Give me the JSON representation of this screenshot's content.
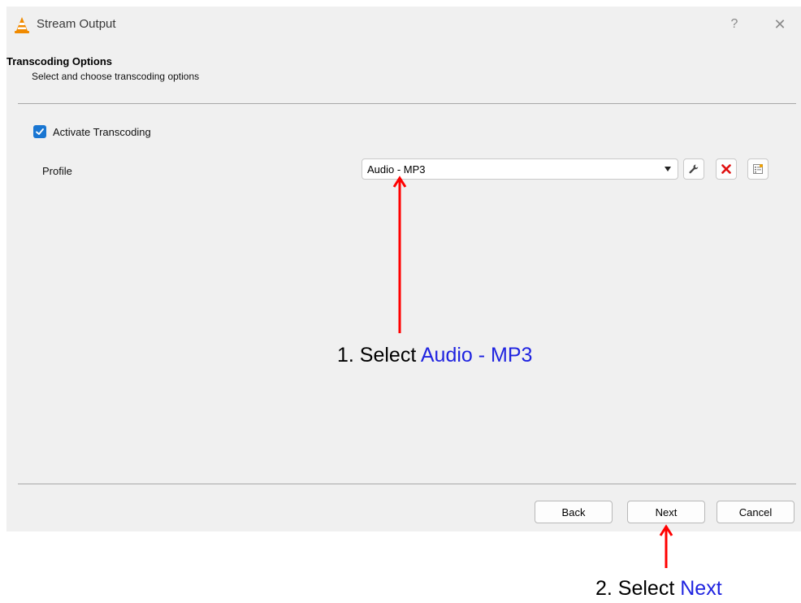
{
  "window": {
    "title": "Stream Output",
    "help_label": "?",
    "close_label": "✕"
  },
  "section": {
    "title": "Transcoding Options",
    "subtitle": "Select and choose transcoding options"
  },
  "transcoding": {
    "activate_label": "Activate Transcoding",
    "activate_checked": true
  },
  "profile": {
    "label": "Profile",
    "selected": "Audio - MP3",
    "tool_icons": [
      "wrench-icon",
      "delete-x-icon",
      "new-profile-icon"
    ]
  },
  "buttons": {
    "back": "Back",
    "next": "Next",
    "cancel": "Cancel"
  },
  "annotations": {
    "step1_prefix": "1. Select ",
    "step1_target": "Audio - MP3",
    "step2_prefix": "2. Select ",
    "step2_target": "Next"
  },
  "colors": {
    "accent": "#1976d2",
    "annotation_arrow": "#ff0000",
    "annotation_highlight": "#1f23e0",
    "vlc_orange": "#f08a00"
  }
}
